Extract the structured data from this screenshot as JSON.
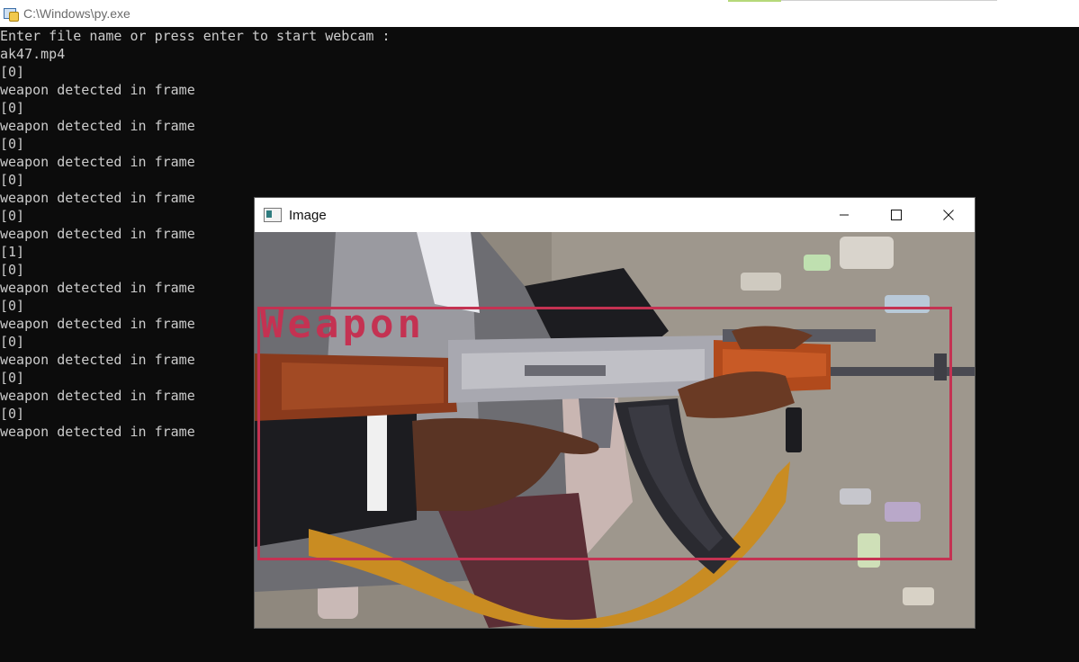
{
  "console": {
    "title": "C:\\Windows\\py.exe",
    "lines": [
      "Enter file name or press enter to start webcam :",
      "ak47.mp4",
      "[0]",
      "weapon detected in frame",
      "[0]",
      "weapon detected in frame",
      "[0]",
      "weapon detected in frame",
      "[0]",
      "weapon detected in frame",
      "[0]",
      "weapon detected in frame",
      "[1]",
      "[0]",
      "weapon detected in frame",
      "[0]",
      "weapon detected in frame",
      "[0]",
      "weapon detected in frame",
      "[0]",
      "weapon detected in frame",
      "[0]",
      "weapon detected in frame"
    ]
  },
  "image_window": {
    "title": "Image",
    "detection_label": "Weapon",
    "detection_color": "#c43252",
    "controls": {
      "minimize_icon": "minimize-icon",
      "maximize_icon": "maximize-icon",
      "close_icon": "close-icon"
    }
  },
  "colors": {
    "console_bg": "#0c0c0c",
    "console_text": "#cccccc"
  }
}
